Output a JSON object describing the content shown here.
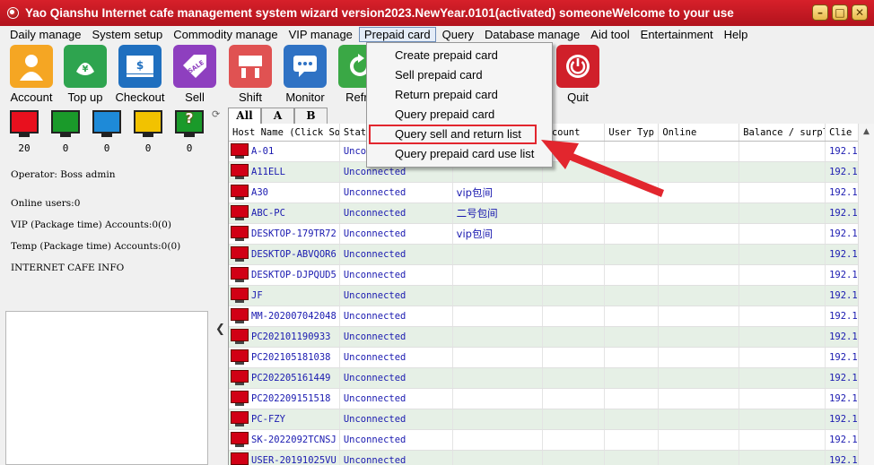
{
  "window": {
    "title": "Yao Qianshu Internet cafe management system wizard version2023.NewYear.0101(activated)  someoneWelcome to your use",
    "minimize_symbol": "–",
    "maximize_symbol": "□",
    "close_symbol": "✕"
  },
  "menu": [
    "Daily manage",
    "System setup",
    "Commodity manage",
    "VIP manage",
    "Prepaid card",
    "Query",
    "Database manage",
    "Aid tool",
    "Entertainment",
    "Help"
  ],
  "toolbar": [
    {
      "label": "Account",
      "icon": "account-icon",
      "color": "#f5a623"
    },
    {
      "label": "Top up",
      "icon": "topup-icon",
      "color": "#2ea44f"
    },
    {
      "label": "Checkout",
      "icon": "checkout-icon",
      "color": "#1f6fbf"
    },
    {
      "label": "Sell",
      "icon": "sell-icon",
      "color": "#8e3fbf"
    },
    {
      "label": "Shift",
      "icon": "shift-icon",
      "color": "#e05252"
    },
    {
      "label": "Monitor",
      "icon": "monitor-icon",
      "color": "#2f72c4"
    },
    {
      "label": "Refre",
      "icon": "refresh-icon",
      "color": "#3aa845"
    },
    {
      "label": "Quit",
      "icon": "power-icon",
      "color": "#d0202a"
    }
  ],
  "dropdown": {
    "items": [
      "Create prepaid card",
      "Sell prepaid card",
      "Return prepaid card",
      "Query prepaid card",
      "Query sell and return list",
      "Query prepaid card use list"
    ],
    "highlighted": "Query sell and return list"
  },
  "status_monitors": [
    {
      "color": "#e8101e",
      "count": "20"
    },
    {
      "color": "#1a9a2a",
      "count": "0"
    },
    {
      "color": "#1e8ad8",
      "count": "0"
    },
    {
      "color": "#f2c200",
      "count": "0"
    },
    {
      "color": "#1a9a2a",
      "count": "0",
      "symbol": "?"
    }
  ],
  "left_info": {
    "operator": "Operator: Boss admin",
    "online_users": "Online users:0",
    "vip": "VIP (Package time) Accounts:0(0)",
    "temp": "Temp (Package time) Accounts:0(0)",
    "cafe_info": "INTERNET CAFE  INFO"
  },
  "tabs": [
    "All",
    "A",
    "B"
  ],
  "table": {
    "columns": [
      "Host Name (Click So",
      "Stat",
      "",
      "ccount",
      "User Typ",
      "Online",
      "Balance / surpl",
      "Clie"
    ],
    "rows": [
      {
        "host": "A-01",
        "status": "Uncon",
        "package": "",
        "client": "192.1"
      },
      {
        "host": "A11ELL",
        "status": "Unconnected",
        "package": "",
        "client": "192.1"
      },
      {
        "host": "A30",
        "status": "Unconnected",
        "package": "vip包间",
        "client": "192.1"
      },
      {
        "host": "ABC-PC",
        "status": "Unconnected",
        "package": "二号包间",
        "client": "192.1"
      },
      {
        "host": "DESKTOP-179TR72",
        "status": "Unconnected",
        "package": "vip包间",
        "client": "192.1"
      },
      {
        "host": "DESKTOP-ABVQOR6",
        "status": "Unconnected",
        "package": "",
        "client": "192.1"
      },
      {
        "host": "DESKTOP-DJPQUD5",
        "status": "Unconnected",
        "package": "",
        "client": "192.1"
      },
      {
        "host": "JF",
        "status": "Unconnected",
        "package": "",
        "client": "192.1"
      },
      {
        "host": "MM-202007042048",
        "status": "Unconnected",
        "package": "",
        "client": "192.1"
      },
      {
        "host": "PC202101190933",
        "status": "Unconnected",
        "package": "",
        "client": "192.1"
      },
      {
        "host": "PC202105181038",
        "status": "Unconnected",
        "package": "",
        "client": "192.1"
      },
      {
        "host": "PC202205161449",
        "status": "Unconnected",
        "package": "",
        "client": "192.1"
      },
      {
        "host": "PC202209151518",
        "status": "Unconnected",
        "package": "",
        "client": "192.1"
      },
      {
        "host": "PC-FZY",
        "status": "Unconnected",
        "package": "",
        "client": "192.1"
      },
      {
        "host": "SK-2022092TCNSJ",
        "status": "Unconnected",
        "package": "",
        "client": "192.1"
      },
      {
        "host": "USER-20191025VU",
        "status": "Unconnected",
        "package": "",
        "client": "192.1"
      }
    ]
  },
  "colors": {
    "titlebar": "#c8161f",
    "highlight_box": "#e2262e",
    "arrow": "#e2262e",
    "row_text": "#1a1ab0",
    "alt_row": "#e6f0e6"
  }
}
